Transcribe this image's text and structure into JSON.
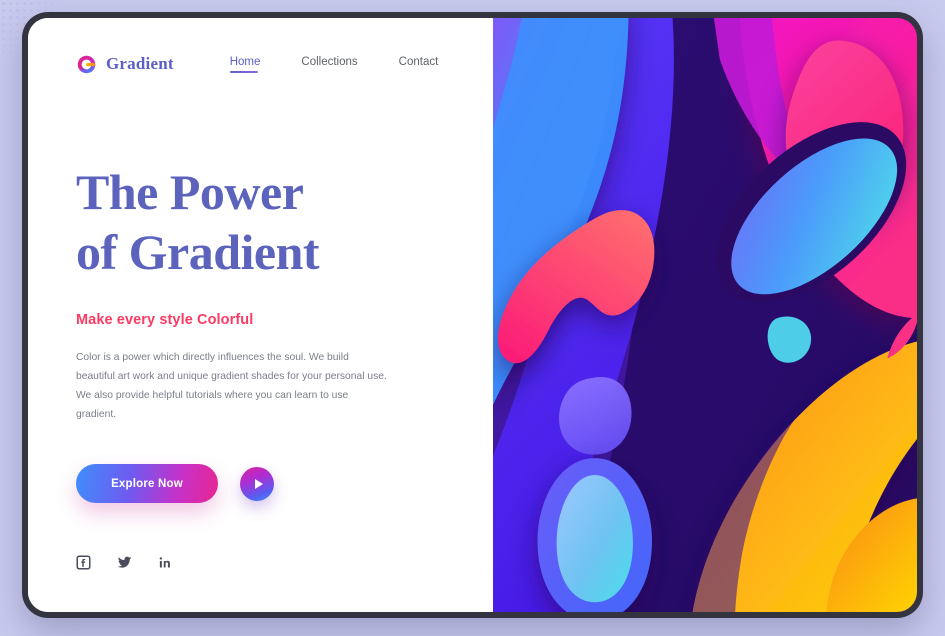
{
  "page": {
    "background_color": "#c8caee",
    "frame_color": "#343440"
  },
  "brand": {
    "name": "Gradient",
    "logo_icon": "google-g-logo-icon",
    "logo_colors": [
      "#e5257e",
      "#c12ad4",
      "#3f8efc",
      "#f9a13a"
    ],
    "accent_color": "#5b5fc7"
  },
  "nav": {
    "links": [
      {
        "label": "Home",
        "active": true
      },
      {
        "label": "Collections",
        "active": false
      },
      {
        "label": "Contact",
        "active": false
      }
    ]
  },
  "hero": {
    "headline": "The Power\nof Gradient",
    "headline_color": "#5b63bd",
    "subheadline": "Make every style Colorful",
    "subheadline_color": "#fb3b63",
    "body": "Color is a power which directly influences the soul. We build beautiful art work and unique gradient shades for your personal use. We also provide helpful tutorials where you can learn to use gradient.",
    "body_color": "#7a7e88"
  },
  "cta": {
    "primary_label": "Explore Now",
    "primary_gradient_from": "#3f8efc",
    "primary_gradient_to": "#e8268f",
    "play_icon": "play-triangle-icon"
  },
  "social": {
    "items": [
      {
        "name": "facebook",
        "label": "Facebook"
      },
      {
        "name": "twitter",
        "label": "Twitter"
      },
      {
        "name": "linkedin",
        "label": "LinkedIn"
      }
    ],
    "icon_color": "#4a4d5c"
  },
  "artwork": {
    "title": "abstract-gradient-blob-composition",
    "base_color": "#3d1a8f",
    "palette": {
      "deep_purple": "#2d0b6e",
      "indigo": "#4b1fc9",
      "violet": "#6d4df5",
      "blue": "#3f8efc",
      "cyan": "#46d8ea",
      "magenta": "#ef1ec4",
      "pink": "#fa2f86",
      "coral": "#ff5d6e",
      "orange": "#fb9a1a",
      "yellow": "#ffd400"
    }
  }
}
